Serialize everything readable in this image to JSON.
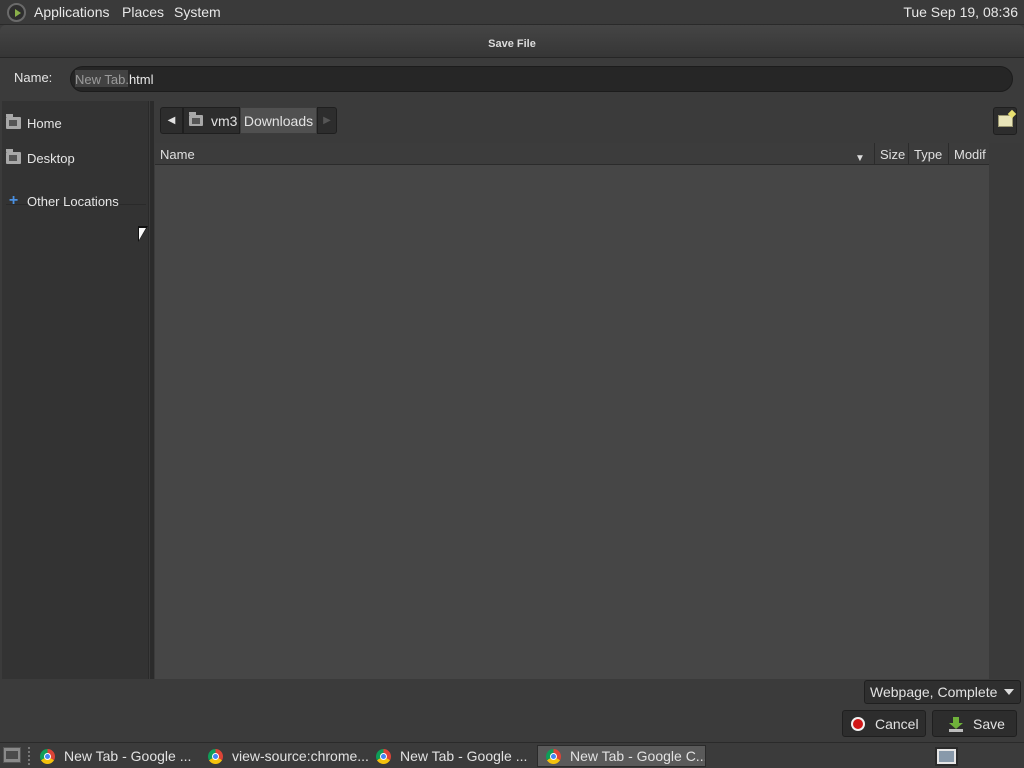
{
  "menubar": {
    "items": [
      "Applications",
      "Places",
      "System"
    ],
    "clock": "Tue Sep 19, 08:36"
  },
  "dialog": {
    "title": "Save File",
    "name_label": "Name:",
    "name_value": "New Tab.html"
  },
  "sidebar": {
    "items": [
      {
        "label": "Home",
        "icon": "home-folder-icon"
      },
      {
        "label": "Desktop",
        "icon": "desktop-folder-icon"
      },
      {
        "label": "Other Locations",
        "icon": "plus-icon"
      }
    ]
  },
  "pathbar": {
    "segments": [
      "vm3",
      "Downloads"
    ],
    "current": "Downloads"
  },
  "columns": {
    "name": "Name",
    "size": "Size",
    "type": "Type",
    "modified": "Modif"
  },
  "filetype": {
    "selected": "Webpage, Complete"
  },
  "buttons": {
    "cancel": "Cancel",
    "save": "Save"
  },
  "taskbar": {
    "tasks": [
      {
        "label": "New Tab - Google ...",
        "active": false
      },
      {
        "label": "view-source:chrome...",
        "active": false
      },
      {
        "label": "New Tab - Google ...",
        "active": false
      },
      {
        "label": "New Tab - Google C...",
        "active": true
      }
    ]
  },
  "colors": {
    "background": "#3a3a3a",
    "list_background": "#464646",
    "selected_path": "#505050",
    "cancel_icon": "#d01717",
    "save_icon": "#6fb13a"
  }
}
